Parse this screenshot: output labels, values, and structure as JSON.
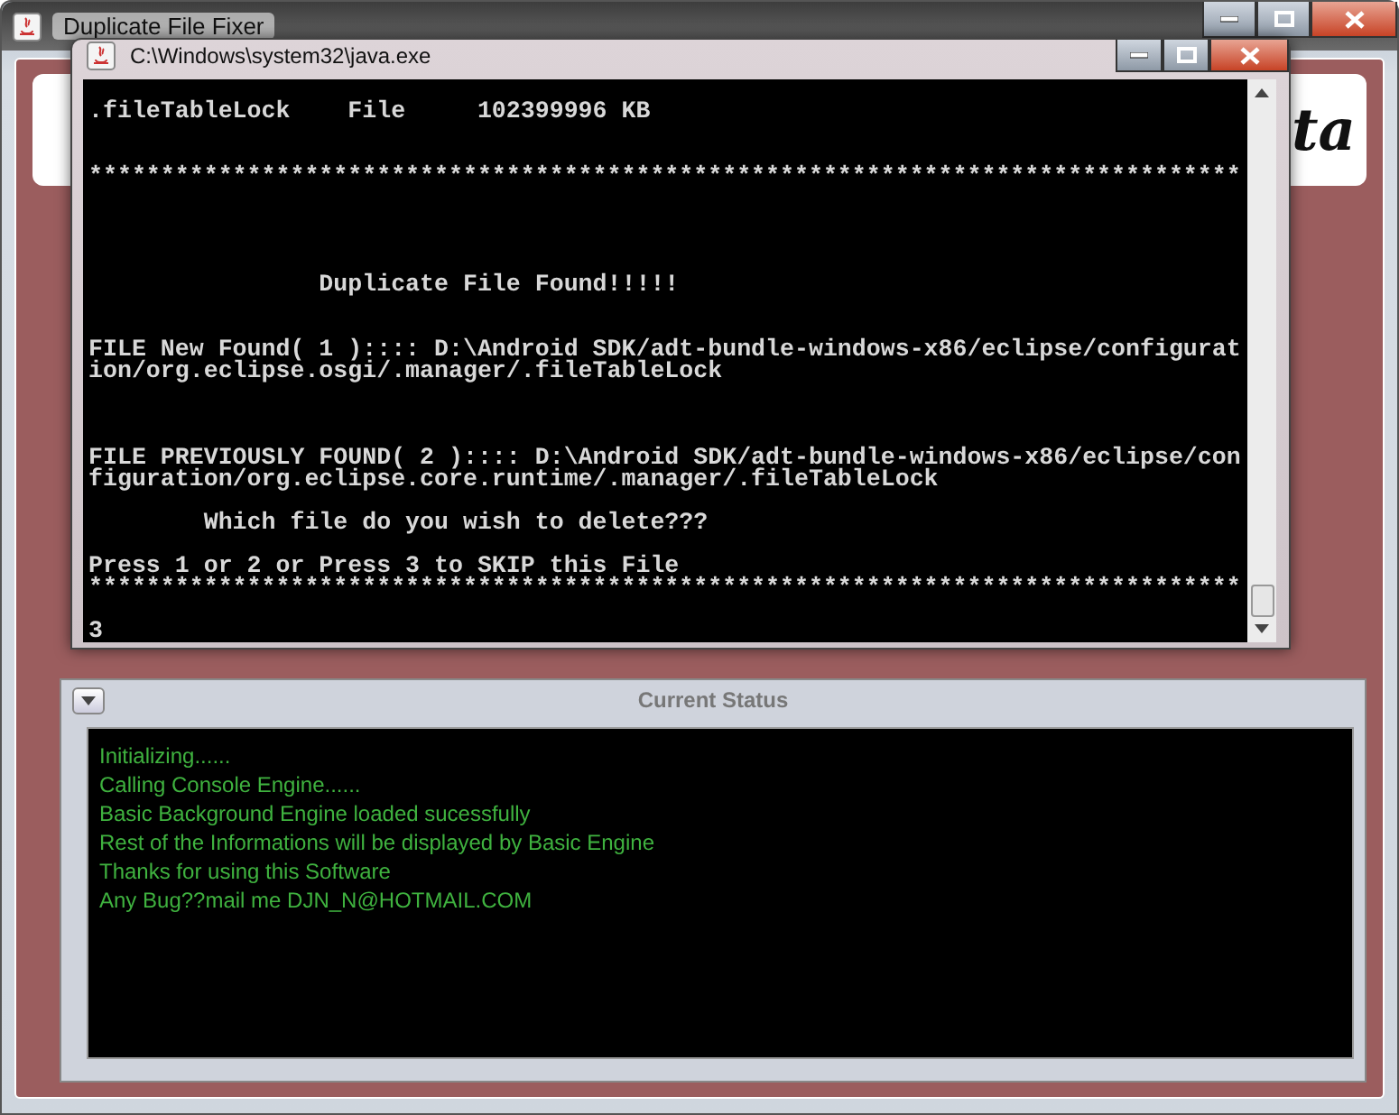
{
  "window": {
    "title": "Duplicate File Fixer"
  },
  "banner": {
    "text": "ta"
  },
  "console_window": {
    "title": "C:\\Windows\\system32\\java.exe",
    "lines": [
      {
        "kind": "text",
        "text": ".fileTableLock    File     102399996 KB"
      },
      {
        "kind": "blank"
      },
      {
        "kind": "blank"
      },
      {
        "kind": "text",
        "text": "********************************************************************************"
      },
      {
        "kind": "blank"
      },
      {
        "kind": "blank"
      },
      {
        "kind": "blank"
      },
      {
        "kind": "blank"
      },
      {
        "kind": "text",
        "text": "                Duplicate File Found!!!!!"
      },
      {
        "kind": "blank"
      },
      {
        "kind": "blank"
      },
      {
        "kind": "text",
        "text": "FILE New Found( 1 ):::: D:\\Android SDK/adt-bundle-windows-x86/eclipse/configurat"
      },
      {
        "kind": "text",
        "text": "ion/org.eclipse.osgi/.manager/.fileTableLock"
      },
      {
        "kind": "blank"
      },
      {
        "kind": "blank"
      },
      {
        "kind": "blank"
      },
      {
        "kind": "text",
        "text": "FILE PREVIOUSLY FOUND( 2 ):::: D:\\Android SDK/adt-bundle-windows-x86/eclipse/con"
      },
      {
        "kind": "text",
        "text": "figuration/org.eclipse.core.runtime/.manager/.fileTableLock"
      },
      {
        "kind": "blank"
      },
      {
        "kind": "text",
        "text": "        Which file do you wish to delete???"
      },
      {
        "kind": "blank"
      },
      {
        "kind": "text",
        "text": "Press 1 or 2 or Press 3 to SKIP this File"
      },
      {
        "kind": "text",
        "text": "********************************************************************************"
      },
      {
        "kind": "blank"
      },
      {
        "kind": "text",
        "text": "3"
      }
    ]
  },
  "status_panel": {
    "title": "Current Status",
    "lines": [
      "Initializing......",
      "Calling Console Engine......",
      "Basic Background Engine loaded sucessfully",
      "Rest of the Informations will be displayed by Basic Engine",
      "Thanks for using this Software",
      "Any Bug??mail me DJN_N@HOTMAIL.COM"
    ]
  }
}
